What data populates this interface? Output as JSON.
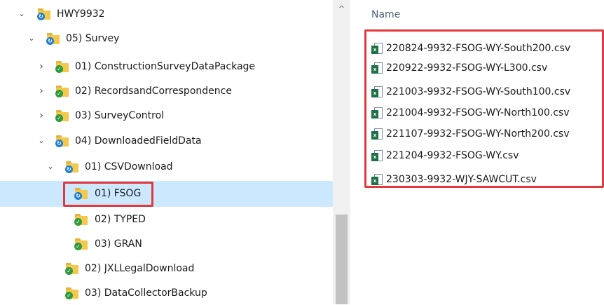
{
  "tree": {
    "items": [
      {
        "label": "HWY9932",
        "chevron": "⌄",
        "icon": "sync-folder-icon"
      },
      {
        "label": "05) Survey",
        "chevron": "⌄",
        "icon": "sync-folder-icon"
      },
      {
        "label": "01) ConstructionSurveyDataPackage",
        "chevron": "›",
        "icon": "synced-folder-icon"
      },
      {
        "label": "02) RecordsandCorrespondence",
        "chevron": "›",
        "icon": "synced-folder-icon"
      },
      {
        "label": "03) SurveyControl",
        "chevron": "›",
        "icon": "synced-folder-icon"
      },
      {
        "label": "04) DownloadedFieldData",
        "chevron": "⌄",
        "icon": "sync-folder-icon"
      },
      {
        "label": "01) CSVDownload",
        "chevron": "⌄",
        "icon": "sync-folder-icon"
      },
      {
        "label": "01) FSOG",
        "chevron": "",
        "icon": "sync-folder-icon",
        "selected": true
      },
      {
        "label": "02) TYPED",
        "chevron": "",
        "icon": "synced-folder-icon"
      },
      {
        "label": "03) GRAN",
        "chevron": "",
        "icon": "synced-folder-icon"
      },
      {
        "label": "02) JXLLegalDownload",
        "chevron": "",
        "icon": "synced-folder-icon"
      },
      {
        "label": "03) DataCollectorBackup",
        "chevron": "",
        "icon": "synced-folder-icon"
      }
    ]
  },
  "scrollbar": {
    "up_arrow": "^"
  },
  "files": {
    "column_header": "Name",
    "items": [
      {
        "name": "220824-9932-FSOG-WY-South200.csv",
        "highlighted": true
      },
      {
        "name": "220922-9932-FSOG-WY-L300.csv",
        "highlighted": true
      },
      {
        "name": "221003-9932-FSOG-WY-South100.csv",
        "highlighted": true
      },
      {
        "name": "221004-9932-FSOG-WY-North100.csv",
        "highlighted": true
      },
      {
        "name": "221107-9932-FSOG-WY-North200.csv",
        "highlighted": true
      },
      {
        "name": "221204-9932-FSOG-WY.csv",
        "highlighted": true
      },
      {
        "name": "230303-9932-WJY-SAWCUT.csv",
        "highlighted": false
      }
    ]
  },
  "colors": {
    "selection": "#cce8ff",
    "highlight_border": "#e0393e",
    "folder": "#f4c84a",
    "sync_badge": "#1e7fd6",
    "synced_badge": "#2e9a3e",
    "csv_badge": "#1e7145"
  }
}
